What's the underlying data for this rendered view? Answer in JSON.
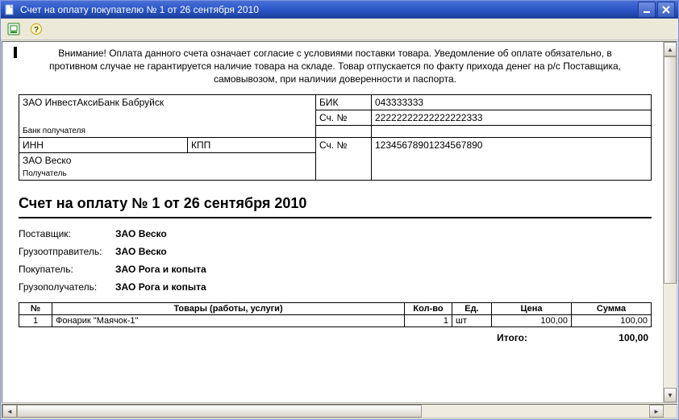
{
  "window": {
    "title": "Счет на оплату покупателю № 1 от 26 сентября 2010"
  },
  "document": {
    "notice": "Внимание! Оплата данного счета означает согласие с условиями поставки товара. Уведомление об оплате обязательно, в противном случае не гарантируется наличие товара на складе. Товар отпускается по факту прихода денег на р/с Поставщика, самовывозом, при наличии доверенности и паспорта.",
    "bank": {
      "recipient_bank_name": "ЗАО ИнвестАксиБанк Бабруйск",
      "recipient_bank_label": "Банк получателя",
      "bik_label": "БИК",
      "bik_value": "043333333",
      "acct1_label": "Сч. №",
      "acct1_value": "22222222222222222333",
      "inn_label": "ИНН",
      "inn_value": "",
      "kpp_label": "КПП",
      "kpp_value": "",
      "acct2_label": "Сч. №",
      "acct2_value": "12345678901234567890",
      "recipient_name": "ЗАО Веско",
      "recipient_label": "Получатель"
    },
    "invoice_title": "Счет на оплату № 1 от 26 сентября 2010",
    "parties": {
      "supplier_label": "Поставщик:",
      "supplier_value": "ЗАО Веско",
      "shipper_label": "Грузоотправитель:",
      "shipper_value": "ЗАО Веско",
      "buyer_label": "Покупатель:",
      "buyer_value": "ЗАО Рога и копыта",
      "consignee_label": "Грузополучатель:",
      "consignee_value": "ЗАО Рога и копыта"
    },
    "items_header": {
      "num": "№",
      "name": "Товары (работы, услуги)",
      "qty": "Кол-во",
      "unit": "Ед.",
      "price": "Цена",
      "sum": "Сумма"
    },
    "items": [
      {
        "num": "1",
        "name": "Фонарик \"Маячок-1\"",
        "qty": "1",
        "unit": "шт",
        "price": "100,00",
        "sum": "100,00"
      }
    ],
    "total": {
      "label": "Итого:",
      "value": "100,00"
    }
  }
}
